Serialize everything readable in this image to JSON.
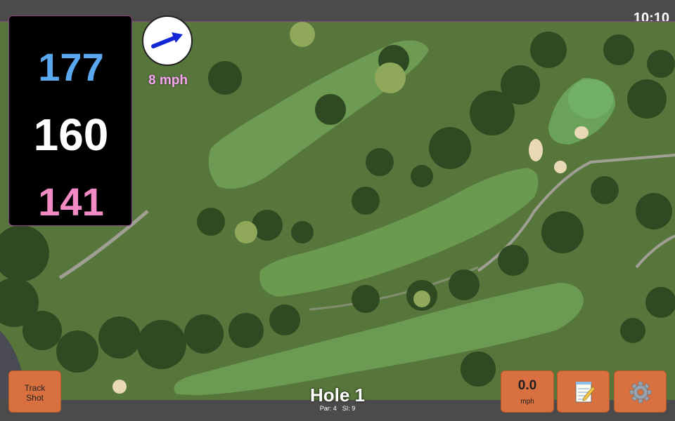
{
  "status": {
    "time": "10:10"
  },
  "distances": {
    "back": "177",
    "middle": "160",
    "front": "141"
  },
  "wind": {
    "speed": "8 mph",
    "direction_icon": "arrow-icon"
  },
  "buttons": {
    "track_line1": "Track",
    "track_line2": "Shot",
    "shot_speed_value": "0.0",
    "shot_speed_unit": "mph",
    "notes_icon": "notepad-icon",
    "settings_icon": "gear-icon"
  },
  "hole": {
    "title": "Hole 1",
    "par": "Par: 4",
    "si": "SI: 9"
  },
  "colors": {
    "back_distance": "#5aa9f0",
    "middle_distance": "#ffffff",
    "front_distance": "#f28ac4",
    "wind_text": "#f4a8ec",
    "button_bg": "#d9703f",
    "arrow": "#1226d6"
  }
}
